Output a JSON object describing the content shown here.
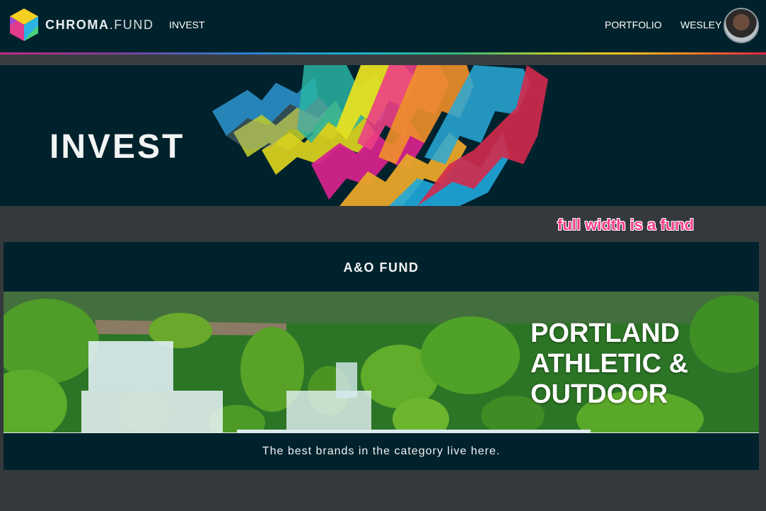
{
  "nav": {
    "brand_primary": "CHROMA",
    "brand_secondary": ".FUND",
    "invest_label": "INVEST",
    "portfolio_label": "PORTFOLIO",
    "user_label": "WESLEY"
  },
  "hero": {
    "title": "INVEST"
  },
  "annotation": {
    "text": "full width is a fund"
  },
  "fund": {
    "name": "A&O FUND",
    "banner_lines": [
      "PORTLAND",
      "ATHLETIC &",
      "OUTDOOR"
    ],
    "tagline": "The best brands in the category live here."
  },
  "colors": {
    "nav_bg": "#00222c",
    "page_bg": "#35393d",
    "annotation": "#ff3d8b"
  }
}
